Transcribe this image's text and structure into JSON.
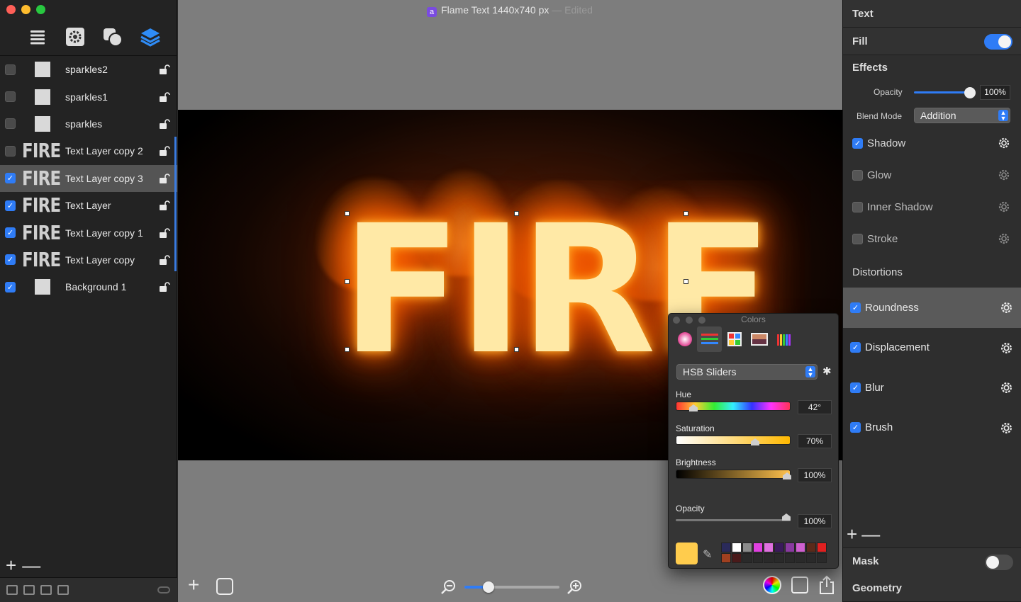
{
  "window": {
    "title": "Flame Text 1440x740 px",
    "edited": "— Edited",
    "app_badge": "a"
  },
  "sidebar": {
    "tools": [
      "list-icon",
      "gear-icon",
      "shapes-icon",
      "layers-icon"
    ],
    "layers": [
      {
        "name": "sparkles2",
        "checked": false,
        "thumb": "blank",
        "selected": false
      },
      {
        "name": "sparkles1",
        "checked": false,
        "thumb": "blank",
        "selected": false
      },
      {
        "name": "sparkles",
        "checked": false,
        "thumb": "blank",
        "selected": false
      },
      {
        "name": "Text Layer copy 2",
        "checked": false,
        "thumb": "FIRE",
        "selected": false
      },
      {
        "name": "Text Layer copy 3",
        "checked": true,
        "thumb": "FIRE",
        "selected": true
      },
      {
        "name": "Text Layer",
        "checked": true,
        "thumb": "FIRE",
        "selected": false
      },
      {
        "name": "Text Layer copy 1",
        "checked": true,
        "thumb": "FIRE",
        "selected": false
      },
      {
        "name": "Text Layer copy",
        "checked": true,
        "thumb": "FIRE",
        "selected": false
      },
      {
        "name": "Background 1",
        "checked": true,
        "thumb": "blank",
        "selected": false
      }
    ],
    "add_label": "+",
    "remove_label": "—"
  },
  "canvas": {
    "text": "FIRE",
    "background": "#000000"
  },
  "bottombar": {
    "add_label": "+",
    "zoom_level": 0.25
  },
  "colors_panel": {
    "title": "Colors",
    "mode": "HSB Sliders",
    "hue": {
      "label": "Hue",
      "value": "42°",
      "level": 0.12
    },
    "saturation": {
      "label": "Saturation",
      "value": "70%",
      "level": 0.7
    },
    "brightness": {
      "label": "Brightness",
      "value": "100%",
      "level": 1.0
    },
    "opacity": {
      "label": "Opacity",
      "value": "100%",
      "level": 1.0
    },
    "current_color": "#ffcc4d",
    "palette": [
      "#2a2a5a",
      "#ffffff",
      "#8a8a8a",
      "#e040e0",
      "#e070e0",
      "#3a1a5a",
      "#8a3aa0",
      "#d060d0",
      "#5a2a1a",
      "#e02020",
      "#a04020",
      "#4a1a1a",
      "#2a2a2a",
      "#2a2a2a",
      "#2a2a2a",
      "#2a2a2a",
      "#2a2a2a",
      "#2a2a2a",
      "#2a2a2a",
      "#2a2a2a"
    ]
  },
  "rpanel": {
    "text_label": "Text",
    "fill_label": "Fill",
    "fill_on": true,
    "effects_label": "Effects",
    "opacity_label": "Opacity",
    "opacity_value": "100%",
    "blend_label": "Blend Mode",
    "blend_value": "Addition",
    "effects": [
      {
        "name": "Shadow",
        "on": true
      },
      {
        "name": "Glow",
        "on": false
      },
      {
        "name": "Inner Shadow",
        "on": false
      },
      {
        "name": "Stroke",
        "on": false
      }
    ],
    "distortions_label": "Distortions",
    "distortions": [
      {
        "name": "Roundness",
        "on": true,
        "selected": true
      },
      {
        "name": "Displacement",
        "on": true,
        "selected": false
      },
      {
        "name": "Blur",
        "on": true,
        "selected": false
      },
      {
        "name": "Brush",
        "on": true,
        "selected": false
      }
    ],
    "add_label": "+",
    "remove_label": "—",
    "mask_label": "Mask",
    "mask_on": false,
    "geometry_label": "Geometry"
  }
}
